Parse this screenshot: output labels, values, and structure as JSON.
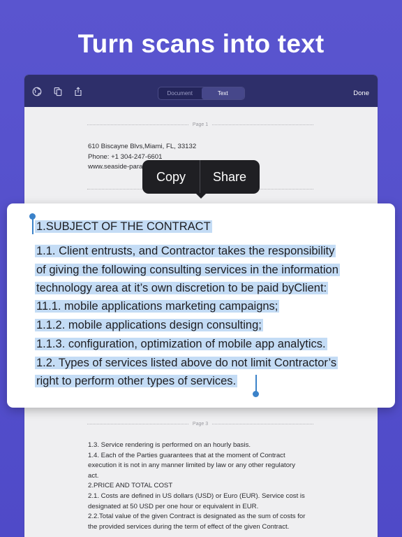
{
  "headline": "Turn scans into text",
  "toolbar": {
    "icons": [
      "globe-icon",
      "copy-icon",
      "share-icon"
    ],
    "tabs": [
      {
        "label": "Document",
        "active": false
      },
      {
        "label": "Text",
        "active": true
      }
    ],
    "done_label": "Done"
  },
  "page1": {
    "label": "Page 1",
    "lines": [
      "610 Biscayne Blvs,Miami, FL, 33132",
      "Phone: +1 304-247-6601",
      "www.seaside-para"
    ]
  },
  "context_menu": {
    "copy_label": "Copy",
    "share_label": "Share"
  },
  "selection": {
    "heading": "1.SUBJECT OF THE CONTRACT",
    "lines": [
      "1.1. Client entrusts, and Contractor takes the responsibility",
      "of giving the following consulting services in the information",
      "technology area at it’s own discretion to be paid byClient:",
      "11.1. mobile applications marketing campaigns;",
      "1.1.2. mobile applications design consulting;",
      "1.1.3. configuration, optimization of mobile app analytics.",
      "1.2. Types of services listed above do not limit Contractor’s",
      "right to perform other types of services."
    ]
  },
  "page3": {
    "label": "Page 3",
    "lines": [
      "1.3. Service rendering is performed on an hourly basis.",
      "1.4. Each of the Parties guarantees that at the moment of Contract",
      "execution it is not in any manner limited by law or any other regulatory",
      "act.",
      "2.PRICE AND TOTAL COST",
      "2.1. Costs are defined in US dollars (USD) or Euro (EUR). Service cost is",
      "designated at 50 USD per one hour or equivalent in EUR.",
      "2.2.Total value of the given Contract is designated as the sum of costs for",
      "the provided services during the term of effect of the given Contract."
    ]
  },
  "colors": {
    "background": "#5a55cf",
    "toolbar": "#2e2f6a",
    "selection_highlight": "#c4dcf5",
    "handle": "#3b82c9"
  }
}
